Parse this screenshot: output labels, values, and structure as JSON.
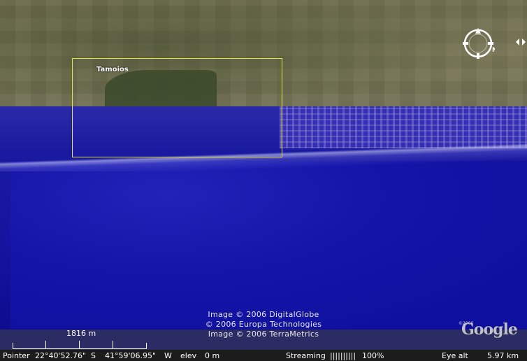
{
  "map": {
    "place_label": "Tamoios",
    "credits": [
      "Image © 2006 DigitalGlobe",
      "© 2006 Europa Technologies",
      "Image © 2006 TerraMetrics"
    ]
  },
  "scale": {
    "label": "1816 m"
  },
  "logo": {
    "text": "Google",
    "copyright": "©2006"
  },
  "compass": {
    "letter": "N"
  },
  "status": {
    "pointer_label": "Pointer",
    "lat": "22°40'52.76\"",
    "lat_dir": "S",
    "lon": "41°59'06.95\"",
    "lon_dir": "W",
    "elev_label": "elev",
    "elev_value": "0 m",
    "streaming_label": "Streaming",
    "streaming_bars": "||||||||||",
    "streaming_percent": "100%",
    "eye_alt_label": "Eye alt",
    "eye_alt_value": "5.97 km"
  },
  "colors": {
    "selection_box": "#e6e64a",
    "overlay_blue": "#1414a0"
  }
}
